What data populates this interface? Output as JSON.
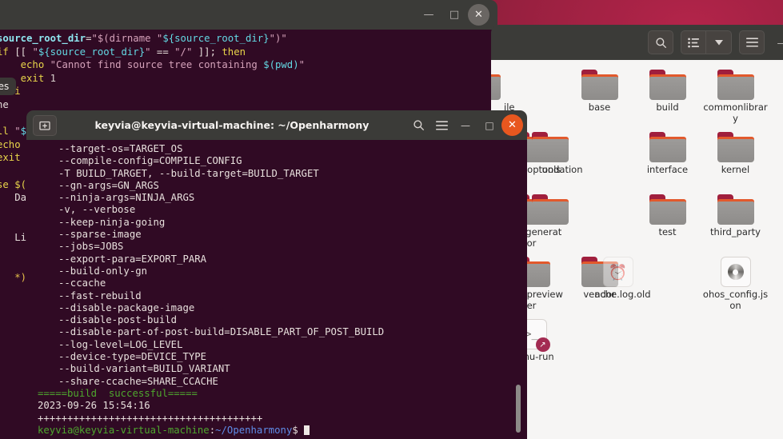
{
  "desktop": {
    "tooltip_label": "iles"
  },
  "background_terminal": {
    "window_controls": {
      "minimize": "—",
      "maximize": "□",
      "close": "✕"
    },
    "lines": [
      "  source_root_dir=\"$(dirname \"${source_root_dir}\")\"",
      "  if [[ \"${source_root_dir}\" == \"/\" ]]; then",
      "      echo \"Cannot find source tree containing $(pwd)\"",
      "      exit 1",
      "    fi",
      "ne",
      "ll  \"${source_root_dir}x\" == \"x\" ]]; then",
      "echo  \"Error: source_root_dir cannot be empty.\"",
      "exit",
      "",
      "se $(",
      "   Dar",
      "",
      "",
      "  Lir",
      "",
      "",
      "  *)"
    ]
  },
  "file_manager": {
    "toolbar": {
      "search_icon": "search-icon",
      "view_list_icon": "list-view-icon",
      "view_dropdown_icon": "chevron-down-icon",
      "menu_icon": "hamburger-menu-icon",
      "minimize_icon": "minimize-icon"
    },
    "items": [
      {
        "name": "ile",
        "type": "folder",
        "partial": true
      },
      {
        "name": "base",
        "type": "folder"
      },
      {
        "name": "build",
        "type": "folder"
      },
      {
        "name": "commonlibrary",
        "type": "folder"
      },
      {
        "name": "developtools",
        "type": "folder"
      },
      {
        "name": "undation",
        "type": "folder",
        "partial": true
      },
      {
        "name": "interface",
        "type": "folder"
      },
      {
        "name": "kernel",
        "type": "folder"
      },
      {
        "name": "napi_generator",
        "type": "folder"
      },
      {
        "name": "",
        "type": "folder",
        "partial": true
      },
      {
        "name": "test",
        "type": "folder"
      },
      {
        "name": "third_party",
        "type": "folder"
      },
      {
        "name": "tools_previewer",
        "type": "folder"
      },
      {
        "name": "vendor",
        "type": "folder"
      },
      {
        "name": "ache.log.old",
        "type": "log-backup",
        "partial": true
      },
      {
        "name": "ohos_config.json",
        "type": "disc-file"
      },
      {
        "name": "qemu-run",
        "type": "script-file"
      }
    ]
  },
  "foreground_terminal": {
    "title": "keyvia@keyvia-virtual-machine: ~/Openharmony",
    "new_tab_icon": "new-tab-icon",
    "search_icon": "search-icon",
    "menu_icon": "hamburger-menu-icon",
    "window_controls": {
      "minimize": "—",
      "maximize": "□",
      "close": "✕"
    },
    "options": [
      "--target-os=TARGET_OS",
      "--compile-config=COMPILE_CONFIG",
      "-T BUILD_TARGET, --build-target=BUILD_TARGET",
      "--gn-args=GN_ARGS",
      "--ninja-args=NINJA_ARGS",
      "-v, --verbose",
      "--keep-ninja-going",
      "--sparse-image",
      "--jobs=JOBS",
      "--export-para=EXPORT_PARA",
      "--build-only-gn",
      "--ccache",
      "--fast-rebuild",
      "--disable-package-image",
      "--disable-post-build",
      "--disable-part-of-post-build=DISABLE_PART_OF_POST_BUILD",
      "--log-level=LOG_LEVEL",
      "--device-type=DEVICE_TYPE",
      "--build-variant=BUILD_VARIANT",
      "--share-ccache=SHARE_CCACHE"
    ],
    "build_status": "=====build  successful=====",
    "timestamp": "2023-09-26 15:54:16",
    "separator": "++++++++++++++++++++++++++++++++++++++",
    "prompt": {
      "user_host": "keyvia@keyvia-virtual-machine",
      "colon": ":",
      "path": "~/Openharmony",
      "sigil": "$"
    }
  },
  "colors": {
    "terminal_bg": "#300a24",
    "titlebar_bg": "#3b3b38",
    "close_accent": "#e8571f",
    "folder_accent": "#e2592c",
    "success_green": "#4ea72e",
    "path_blue": "#5f8ce8"
  }
}
